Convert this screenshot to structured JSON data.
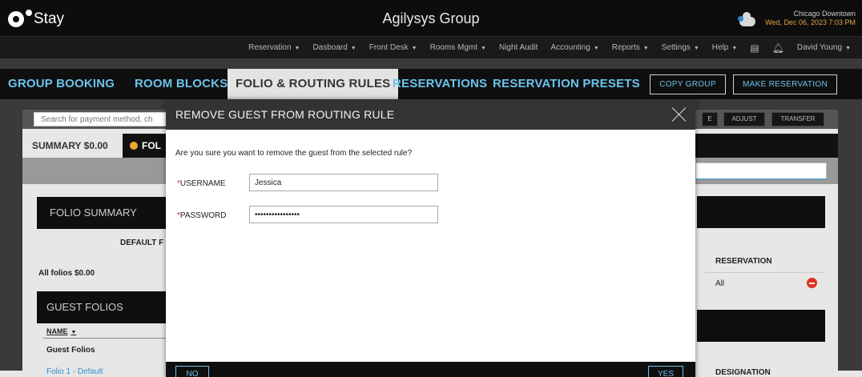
{
  "header": {
    "logo_text": "Stay",
    "app_title": "Agilysys Group",
    "location": "Chicago Downtown",
    "datetime": "Wed, Dec 06, 2023 7:03 PM"
  },
  "menu": [
    {
      "label": "Reservation",
      "caret": true
    },
    {
      "label": "Dasboard",
      "caret": true
    },
    {
      "label": "Front Desk",
      "caret": true
    },
    {
      "label": "Rooms Mgmt",
      "caret": true
    },
    {
      "label": "Night Audit",
      "caret": false
    },
    {
      "label": "Accounting",
      "caret": true
    },
    {
      "label": "Reports",
      "caret": true
    },
    {
      "label": "Settings",
      "caret": true
    },
    {
      "label": "Help",
      "caret": true
    }
  ],
  "user": {
    "name": "David Young"
  },
  "tabs": {
    "group_booking": "GROUP BOOKING",
    "room_blocks": "ROOM BLOCKS",
    "folio_routing": "FOLIO & ROUTING RULES",
    "reservations": "RESERVATIONS",
    "reservation_presets": "RESERVATION PRESETS",
    "copy_group": "COPY GROUP",
    "make_reservation": "MAKE RESERVATION"
  },
  "background": {
    "search_placeholder": "Search for payment method, ch",
    "adjust": "ADJUST",
    "transfer": "TRANSFER",
    "e_btn": "E",
    "summary_tab": "SUMMARY $0.00",
    "fol_tab": "FOL",
    "folio_summary": "FOLIO SUMMARY",
    "default_f": "DEFAULT F",
    "all_folios": "All folios $0.00",
    "guest_folios": "GUEST FOLIOS",
    "name_col": "NAME",
    "guest_folios_row": "Guest Folios",
    "folio_1": "Folio 1 - Default",
    "reservation_col": "RESERVATION",
    "all_value": "All",
    "designation_col": "DESIGNATION"
  },
  "modal": {
    "title": "REMOVE GUEST FROM ROUTING RULE",
    "message": "Are you sure you want to remove the guest from the selected rule?",
    "username_label": "USERNAME",
    "username_value": "Jessica",
    "password_label": "PASSWORD",
    "password_value": "••••••••••••••••",
    "no_label": "NO",
    "yes_label": "YES"
  }
}
